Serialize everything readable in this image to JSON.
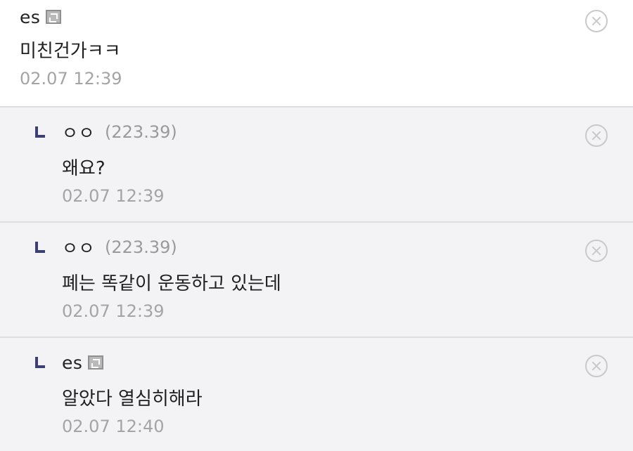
{
  "comments": [
    {
      "author": "es",
      "badge": "fixed-nick-icon",
      "text": "미친건가ㅋㅋ",
      "time": "02.07 12:39"
    },
    {
      "author": "ㅇㅇ",
      "ip": "(223.39)",
      "text": "왜요?",
      "time": "02.07 12:39"
    },
    {
      "author": "ㅇㅇ",
      "ip": "(223.39)",
      "text": "폐는 똑같이 운동하고 있는데",
      "time": "02.07 12:39"
    },
    {
      "author": "es",
      "badge": "fixed-nick-icon",
      "text": "알았다 열심히해라",
      "time": "02.07 12:40"
    }
  ],
  "icons": {
    "reply": "reply-arrow-icon",
    "delete": "close-circle-icon"
  },
  "colors": {
    "reply_background": "#f3f3f6",
    "reply_mark": "#3b3f72",
    "meta_gray": "#a4a4a4"
  }
}
